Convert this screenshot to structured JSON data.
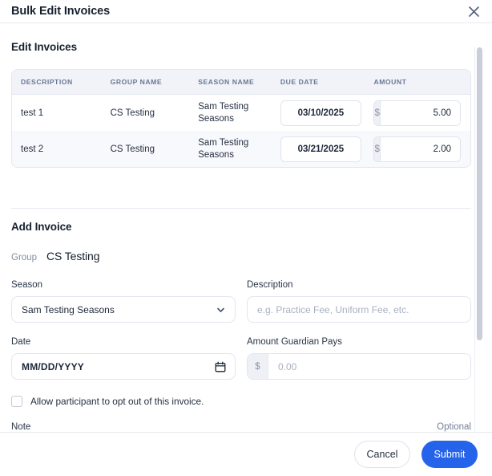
{
  "header": {
    "title": "Bulk Edit Invoices",
    "close_icon": "close-icon"
  },
  "edit_invoices": {
    "section_title": "Edit Invoices",
    "columns": [
      "DESCRIPTION",
      "GROUP NAME",
      "SEASON NAME",
      "DUE DATE",
      "AMOUNT"
    ],
    "currency_symbol": "$",
    "rows": [
      {
        "description": "test 1",
        "group_name": "CS Testing",
        "season_name": "Sam Testing Seasons",
        "due_date": "03/10/2025",
        "amount": "5.00"
      },
      {
        "description": "test 2",
        "group_name": "CS Testing",
        "season_name": "Sam Testing Seasons",
        "due_date": "03/21/2025",
        "amount": "2.00"
      }
    ]
  },
  "add_invoice": {
    "section_title": "Add Invoice",
    "group_label": "Group",
    "group_value": "CS Testing",
    "season": {
      "label": "Season",
      "value": "Sam Testing Seasons",
      "icon": "chevron-down-icon"
    },
    "description": {
      "label": "Description",
      "value": "",
      "placeholder": "e.g. Practice Fee, Uniform Fee, etc."
    },
    "date": {
      "label": "Date",
      "value": "MM/DD/YYYY",
      "icon": "calendar-icon"
    },
    "amount_guardian_pays": {
      "label": "Amount Guardian Pays",
      "currency_symbol": "$",
      "value": "",
      "placeholder": "0.00"
    },
    "opt_out": {
      "label": "Allow participant to opt out of this invoice.",
      "checked": false
    },
    "note": {
      "label": "Note",
      "optional_label": "Optional",
      "value": "",
      "placeholder": ""
    }
  },
  "footer": {
    "cancel_label": "Cancel",
    "submit_label": "Submit",
    "submit_color": "#2563eb"
  }
}
